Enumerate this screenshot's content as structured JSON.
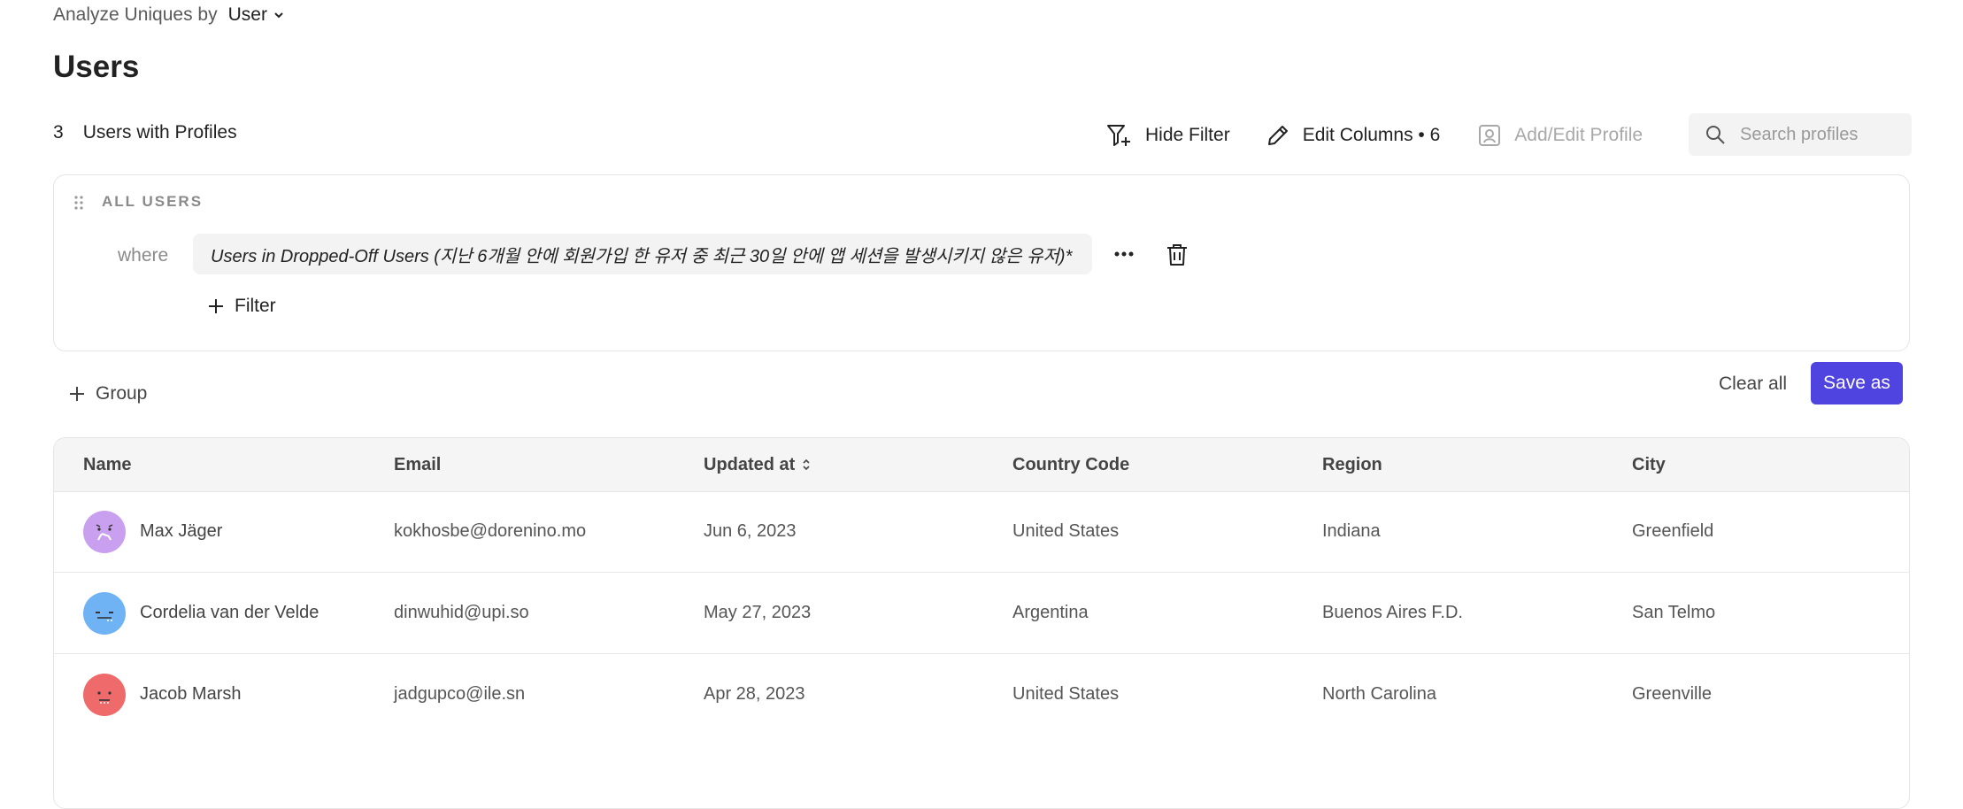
{
  "header": {
    "analyze_label": "Analyze Uniques by",
    "analyze_value": "User",
    "title": "Users",
    "count": "3",
    "count_label": "Users with Profiles"
  },
  "toolbar": {
    "hide_filter": "Hide Filter",
    "edit_columns": "Edit Columns • 6",
    "add_edit_profile": "Add/Edit Profile",
    "search_placeholder": "Search profiles"
  },
  "filter": {
    "section_label": "ALL USERS",
    "where_label": "where",
    "condition": "Users in Dropped-Off Users (지난 6개월 안에 회원가입 한 유저 중 최근 30일 안에 앱 세션을 발생시키지 않은 유저)*",
    "add_filter_label": "Filter"
  },
  "actions": {
    "group_label": "Group",
    "clear_all": "Clear all",
    "save_as": "Save as"
  },
  "table": {
    "columns": [
      "Name",
      "Email",
      "Updated at",
      "Country Code",
      "Region",
      "City"
    ],
    "rows": [
      {
        "name": "Max Jäger",
        "email": "kokhosbe@dorenino.mo",
        "updated": "Jun 6, 2023",
        "country": "United States",
        "region": "Indiana",
        "city": "Greenfield",
        "avatar_color": "#c9a0f0"
      },
      {
        "name": "Cordelia van der Velde",
        "email": "dinwuhid@upi.so",
        "updated": "May 27, 2023",
        "country": "Argentina",
        "region": "Buenos Aires F.D.",
        "city": "San Telmo",
        "avatar_color": "#6fb3f5"
      },
      {
        "name": "Jacob Marsh",
        "email": "jadgupco@ile.sn",
        "updated": "Apr 28, 2023",
        "country": "United States",
        "region": "North Carolina",
        "city": "Greenville",
        "avatar_color": "#ef6b6b"
      }
    ]
  },
  "colors": {
    "accent": "#4f44e0",
    "chip_bg": "#f3f3f3",
    "header_bg": "#f5f5f5"
  }
}
